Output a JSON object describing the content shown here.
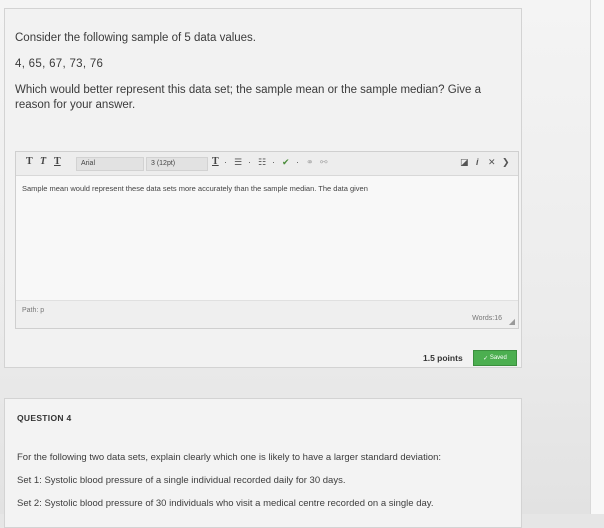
{
  "question3": {
    "intro": "Consider the following sample of 5 data values.",
    "values": "4, 65, 67, 73, 76",
    "question": "Which would better represent this data set; the sample mean or the sample median? Give a reason for your answer.",
    "editor": {
      "toolbar": {
        "bold": "T",
        "italic": "T",
        "underline": "T",
        "font_family": "Arial",
        "font_size": "3 (12pt)",
        "text_color": "T"
      },
      "content": "Sample mean would represent these data sets more accurately than the sample median. The data given",
      "path": "Path: p",
      "words": "Words:16"
    },
    "points": "1.5 points",
    "status": "Saved"
  },
  "question4": {
    "label": "QUESTION 4",
    "prompt": "For the following two data sets, explain clearly which one is likely to have a larger standard deviation:",
    "set1": "Set 1: Systolic blood pressure of a single individual recorded daily for 30 days.",
    "set2": "Set 2: Systolic blood pressure of 30 individuals who visit a medical centre recorded on a single day."
  },
  "colors": {
    "saved_green": "#4caf50"
  }
}
